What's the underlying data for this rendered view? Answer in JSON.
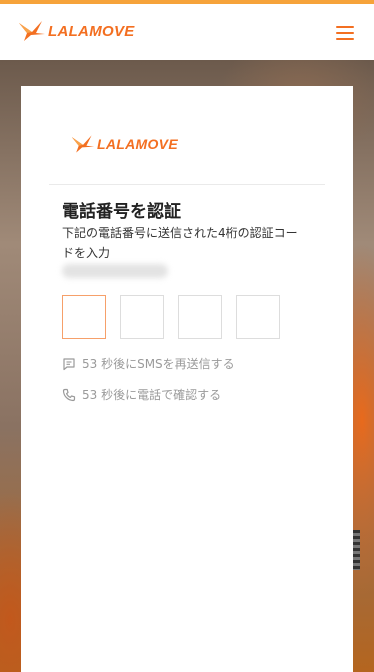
{
  "brand": {
    "name": "LALAMOVE",
    "color": "#f36f21"
  },
  "header": {
    "menu_icon": "hamburger-menu-icon"
  },
  "verify": {
    "title": "電話番号を認証",
    "description": "下記の電話番号に送信された4桁の認証コードを入力",
    "phone_masked": "•••••••••••",
    "code_length": 4,
    "sms_resend": "53 秒後にSMSを再送信する",
    "call_verify": "53 秒後に電話で確認する"
  }
}
